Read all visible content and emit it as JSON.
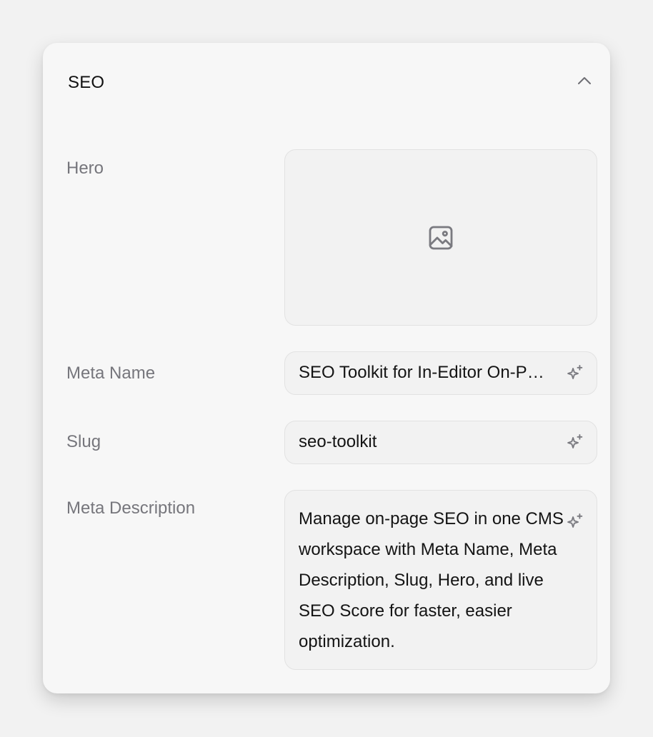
{
  "panel": {
    "title": "SEO",
    "collapse_icon": "chevron-up-icon"
  },
  "fields": {
    "hero": {
      "label": "Hero",
      "placeholder_icon": "image-icon"
    },
    "meta_name": {
      "label": "Meta Name",
      "value": "SEO Toolkit for In-Editor On-Page Optimization",
      "action_icon": "sparkle-icon"
    },
    "slug": {
      "label": "Slug",
      "value": "seo-toolkit",
      "action_icon": "sparkle-icon"
    },
    "meta_description": {
      "label": "Meta Description",
      "value": "Manage on-page SEO in one CMS workspace with Meta Name, Meta Description, Slug, Hero, and live SEO Score for faster, easier optimization.",
      "action_icon": "sparkle-icon"
    }
  },
  "colors": {
    "background": "#f2f2f2",
    "panel": "#f7f7f7",
    "label": "#76767c",
    "text": "#141414",
    "icon": "#7a7a80"
  }
}
